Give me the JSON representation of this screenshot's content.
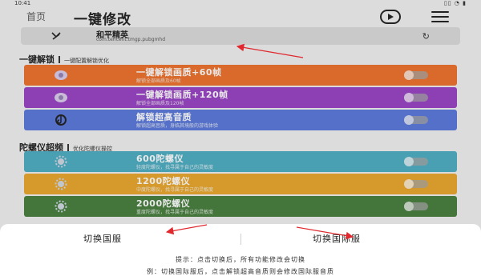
{
  "status_bar": {
    "time": "10:41",
    "indicators": "▯▯ ◔ ▮"
  },
  "header": {
    "home": "首页",
    "title": "一键修改",
    "play_icon": "play-circle-icon",
    "menu_icon": "hamburger-menu-icon"
  },
  "game": {
    "name": "和平精英",
    "package": "com.tencent.tmgp.pubgmhd",
    "refresh_icon": "refresh-icon"
  },
  "section_unlock": {
    "title": "一键解锁",
    "subtitle": "一键配置解锁优化"
  },
  "unlock_items": [
    {
      "title": "一键解锁画质+60帧",
      "desc": "解锁全部画质及60帧",
      "color": "#d96a2b",
      "icon": "gamepad-icon",
      "enabled": false
    },
    {
      "title": "一键解锁画质+120帧",
      "desc": "解锁全部画质及120帧",
      "color": "#8d3fb4",
      "icon": "gamepad-icon",
      "enabled": false
    },
    {
      "title": "解锁超高音质",
      "desc": "解锁超高音质，身临其境般的游戏体验",
      "color": "#5570c9",
      "icon": "tiktok-icon",
      "enabled": false
    }
  ],
  "section_gyro": {
    "title": "陀螺仪超频",
    "subtitle": "优化陀螺仪操控"
  },
  "gyro_items": [
    {
      "title": "600陀螺仪",
      "desc": "轻度陀螺仪，找寻属于自己的灵敏度",
      "color": "#4aa0b3",
      "icon": "gear-icon",
      "enabled": false
    },
    {
      "title": "1200陀螺仪",
      "desc": "中度陀螺仪，找寻属于自己的灵敏度",
      "color": "#d69a2c",
      "icon": "gear-icon",
      "enabled": false
    },
    {
      "title": "2000陀螺仪",
      "desc": "重度陀螺仪，找寻属于自己的灵敏度",
      "color": "#44763c",
      "icon": "gear-icon",
      "enabled": false
    }
  ],
  "sheet": {
    "option_domestic": "切换国服",
    "option_international": "切换国际服",
    "tip1": "提示：点击切换后，所有功能修改会切换",
    "tip2": "例：切换国际服后，点击解锁超高音质则会修改国际服音质"
  },
  "colors": {
    "arrow": "#e0282e",
    "sheet_bg": "#ffffff",
    "page_bg": "#dcdcdc"
  }
}
